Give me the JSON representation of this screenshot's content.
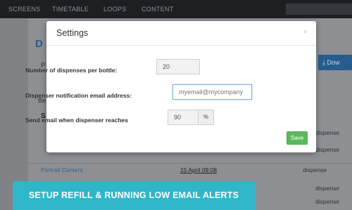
{
  "nav": {
    "items": [
      "SCREENS",
      "TIMETABLE",
      "LOOPS",
      "CONTENT"
    ]
  },
  "background": {
    "title_fragment": "D",
    "p_fragment": "P",
    "be_fragment": "Be",
    "s_fragment": "S",
    "download_label": "Dow",
    "rows": [
      {
        "name": "Portrait Content",
        "date": "15 April 09:08",
        "type": "dispense"
      }
    ],
    "right_values": [
      "dispense",
      "dispense",
      "dispense",
      "dispense"
    ]
  },
  "modal": {
    "title": "Settings",
    "close": "×",
    "dispenses_label": "Number of dispenses per bottle:",
    "dispenses_value": "20",
    "email_label": "Dispenser notification email address:",
    "email_value": "myemail@mycompany",
    "threshold_label": "Send email when dispenser reaches",
    "threshold_value": "90",
    "threshold_unit": "%",
    "save_label": "Save"
  },
  "banner": {
    "text": "SETUP REFILL & RUNNING LOW EMAIL ALERTS"
  },
  "colors": {
    "accent": "#2fb7c9",
    "save": "#5cb85c",
    "nav": "#1d2023"
  }
}
